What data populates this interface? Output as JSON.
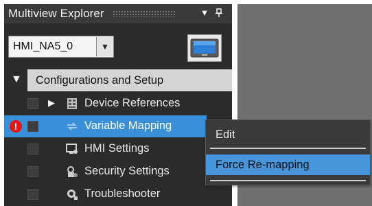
{
  "panel": {
    "title": "Multiview Explorer",
    "dropdown_icon": "▼",
    "pin_icon": "pin-icon"
  },
  "hmi": {
    "selected": "HMI_NA5_0",
    "arrow": "▼",
    "device_icon": "hmi-device-icon"
  },
  "tree": {
    "section_label": "Configurations and Setup",
    "section_toggle": "▼",
    "items": [
      {
        "label": "Device References",
        "expander": "▶",
        "icon": "device-references-icon"
      },
      {
        "label": "Variable Mapping",
        "icon": "variable-mapping-icon",
        "warning": "!"
      },
      {
        "label": "HMI Settings",
        "icon": "hmi-settings-icon"
      },
      {
        "label": "Security Settings",
        "icon": "security-settings-icon"
      },
      {
        "label": "Troubleshooter",
        "icon": "troubleshooter-icon"
      }
    ]
  },
  "context_menu": {
    "items": [
      {
        "label": "Edit"
      },
      {
        "label": "Force Re-mapping"
      }
    ]
  },
  "colors": {
    "selection": "#3a8fd9",
    "menu_highlight": "#4796dc",
    "warning": "#e21818"
  }
}
